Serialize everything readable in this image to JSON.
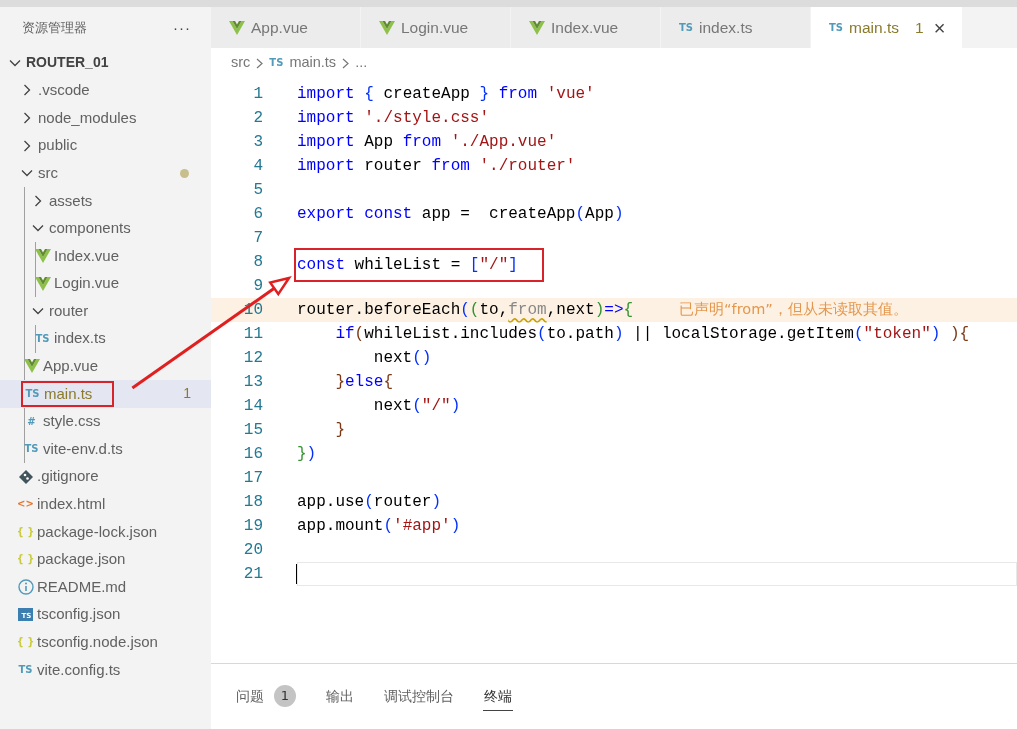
{
  "explorer": {
    "title": "资源管理器",
    "more": "···",
    "root": {
      "label": "ROUTER_01",
      "expanded": true
    },
    "items": [
      {
        "label": ".vscode",
        "kind": "folder",
        "expanded": false
      },
      {
        "label": "node_modules",
        "kind": "folder",
        "expanded": false
      },
      {
        "label": "public",
        "kind": "folder",
        "expanded": false
      },
      {
        "label": "src",
        "kind": "folder",
        "expanded": true,
        "modified": true,
        "children": [
          {
            "label": "assets",
            "kind": "folder",
            "expanded": false
          },
          {
            "label": "components",
            "kind": "folder",
            "expanded": true,
            "children": [
              {
                "label": "Index.vue",
                "kind": "vue"
              },
              {
                "label": "Login.vue",
                "kind": "vue"
              }
            ]
          },
          {
            "label": "router",
            "kind": "folder",
            "expanded": true,
            "children": [
              {
                "label": "index.ts",
                "kind": "ts",
                "icon_text": "TS"
              }
            ]
          },
          {
            "label": "App.vue",
            "kind": "vue"
          },
          {
            "label": "main.ts",
            "kind": "ts",
            "icon_text": "TS",
            "selected": true,
            "warning": true,
            "problems": "1",
            "annotated": true
          },
          {
            "label": "style.css",
            "kind": "css",
            "icon_text": "#"
          },
          {
            "label": "vite-env.d.ts",
            "kind": "ts",
            "icon_text": "TS"
          }
        ]
      },
      {
        "label": ".gitignore",
        "kind": "git"
      },
      {
        "label": "index.html",
        "kind": "html",
        "icon_text": "<>"
      },
      {
        "label": "package-lock.json",
        "kind": "json",
        "icon_text": "{ }"
      },
      {
        "label": "package.json",
        "kind": "json",
        "icon_text": "{ }"
      },
      {
        "label": "README.md",
        "kind": "info"
      },
      {
        "label": "tsconfig.json",
        "kind": "tsconfig",
        "icon_text": "TS"
      },
      {
        "label": "tsconfig.node.json",
        "kind": "json",
        "icon_text": "{ }"
      },
      {
        "label": "vite.config.ts",
        "kind": "ts",
        "icon_text": "TS"
      }
    ]
  },
  "tabs": [
    {
      "label": "App.vue",
      "kind": "vue",
      "selected": false
    },
    {
      "label": "Login.vue",
      "kind": "vue",
      "selected": false
    },
    {
      "label": "Index.vue",
      "kind": "vue",
      "selected": false
    },
    {
      "label": "index.ts",
      "kind": "ts",
      "icon_text": "TS",
      "selected": false
    },
    {
      "label": "main.ts",
      "kind": "ts",
      "icon_text": "TS",
      "selected": true,
      "warning": true,
      "problems": "1",
      "close": "×"
    }
  ],
  "editor": {
    "breadcrumb": [
      {
        "text": "src"
      },
      {
        "text": "main.ts",
        "icon_text": "TS"
      },
      {
        "text": "..."
      }
    ],
    "lines": [
      {
        "number": "1",
        "tokens": [
          {
            "text": "import ",
            "kind": "kw"
          },
          {
            "text": "{",
            "kind": "b1"
          },
          {
            "text": " createApp ",
            "kind": "id"
          },
          {
            "text": "}",
            "kind": "b1"
          },
          {
            "text": " from ",
            "kind": "kw"
          },
          {
            "text": "'vue'",
            "kind": "str"
          }
        ]
      },
      {
        "number": "2",
        "tokens": [
          {
            "text": "import ",
            "kind": "kw"
          },
          {
            "text": "'./style.css'",
            "kind": "str"
          }
        ]
      },
      {
        "number": "3",
        "tokens": [
          {
            "text": "import",
            "kind": "kw"
          },
          {
            "text": " App ",
            "kind": "id"
          },
          {
            "text": "from ",
            "kind": "kw"
          },
          {
            "text": "'./App.vue'",
            "kind": "str"
          }
        ]
      },
      {
        "number": "4",
        "tokens": [
          {
            "text": "import",
            "kind": "kw"
          },
          {
            "text": " router ",
            "kind": "id"
          },
          {
            "text": "from ",
            "kind": "kw"
          },
          {
            "text": "'./router'",
            "kind": "str"
          }
        ]
      },
      {
        "number": "5"
      },
      {
        "number": "6",
        "tokens": [
          {
            "text": "export const",
            "kind": "kw"
          },
          {
            "text": " app =  createApp",
            "kind": "id"
          },
          {
            "text": "(",
            "kind": "b1"
          },
          {
            "text": "App",
            "kind": "id"
          },
          {
            "text": ")",
            "kind": "b1"
          }
        ]
      },
      {
        "number": "7"
      },
      {
        "number": "8",
        "annotated": true,
        "tokens": [
          {
            "text": "const",
            "kind": "kw"
          },
          {
            "text": " whileList = ",
            "kind": "id"
          },
          {
            "text": "[",
            "kind": "b1"
          },
          {
            "text": "\"/\"",
            "kind": "str"
          },
          {
            "text": "]",
            "kind": "b1"
          }
        ]
      },
      {
        "number": "9"
      },
      {
        "number": "10",
        "warning": true,
        "hint": "已声明“from”，但从未读取其值。",
        "tokens": [
          {
            "text": "router.beforeEach",
            "kind": "id"
          },
          {
            "text": "(",
            "kind": "b1"
          },
          {
            "text": "(",
            "kind": "b2"
          },
          {
            "text": "to,",
            "kind": "id"
          },
          {
            "text": "from",
            "kind": "unused"
          },
          {
            "text": ",next",
            "kind": "id"
          },
          {
            "text": ")",
            "kind": "b2"
          },
          {
            "text": "=>",
            "kind": "kw"
          },
          {
            "text": "{",
            "kind": "b2"
          }
        ]
      },
      {
        "number": "11",
        "tokens": [
          {
            "text": "    if",
            "kind": "kw"
          },
          {
            "text": "(",
            "kind": "b3"
          },
          {
            "text": "whileList.includes",
            "kind": "id"
          },
          {
            "text": "(",
            "kind": "b1"
          },
          {
            "text": "to.path",
            "kind": "id"
          },
          {
            "text": ")",
            "kind": "b1"
          },
          {
            "text": " || localStorage.getItem",
            "kind": "id"
          },
          {
            "text": "(",
            "kind": "b1"
          },
          {
            "text": "\"token\"",
            "kind": "str"
          },
          {
            "text": ")",
            "kind": "b1"
          },
          {
            "text": " )",
            "kind": "b3"
          },
          {
            "text": "{",
            "kind": "b3"
          }
        ]
      },
      {
        "number": "12",
        "tokens": [
          {
            "text": "        next",
            "kind": "id"
          },
          {
            "text": "()",
            "kind": "b1"
          }
        ]
      },
      {
        "number": "13",
        "tokens": [
          {
            "text": "    }",
            "kind": "b3"
          },
          {
            "text": "else",
            "kind": "kw"
          },
          {
            "text": "{",
            "kind": "b3"
          }
        ]
      },
      {
        "number": "14",
        "tokens": [
          {
            "text": "        next",
            "kind": "id"
          },
          {
            "text": "(",
            "kind": "b1"
          },
          {
            "text": "\"/\"",
            "kind": "str"
          },
          {
            "text": ")",
            "kind": "b1"
          }
        ]
      },
      {
        "number": "15",
        "tokens": [
          {
            "text": "    }",
            "kind": "b3"
          }
        ]
      },
      {
        "number": "16",
        "tokens": [
          {
            "text": "}",
            "kind": "b2"
          },
          {
            "text": ")",
            "kind": "b1"
          }
        ]
      },
      {
        "number": "17"
      },
      {
        "number": "18",
        "tokens": [
          {
            "text": "app.use",
            "kind": "id"
          },
          {
            "text": "(",
            "kind": "b1"
          },
          {
            "text": "router",
            "kind": "id"
          },
          {
            "text": ")",
            "kind": "b1"
          }
        ]
      },
      {
        "number": "19",
        "tokens": [
          {
            "text": "app.mount",
            "kind": "id"
          },
          {
            "text": "(",
            "kind": "b1"
          },
          {
            "text": "'#app'",
            "kind": "str"
          },
          {
            "text": ")",
            "kind": "b1"
          }
        ]
      },
      {
        "number": "20"
      },
      {
        "number": "21",
        "current": true
      }
    ]
  },
  "panel": {
    "tabs": [
      {
        "label": "问题",
        "count": "1",
        "selected": false
      },
      {
        "label": "输出",
        "selected": false
      },
      {
        "label": "调试控制台",
        "selected": false
      },
      {
        "label": "终端",
        "selected": true
      }
    ]
  }
}
